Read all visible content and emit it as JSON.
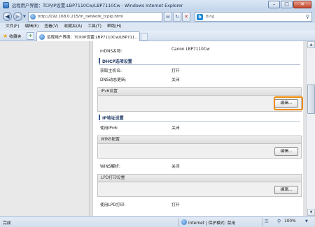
{
  "window": {
    "title": "远程用户界面：TCP/IP设置:LBP7110Cw/LBP7110Cw - Windows Internet Explorer",
    "minimize": "–",
    "maximize": "□",
    "close": "✕"
  },
  "address_bar": {
    "url": "http://192.168.0.215/m_network_tcpip.html",
    "search_placeholder": "Bing"
  },
  "menu": [
    "文件(F)",
    "编辑(E)",
    "查看(V)",
    "收藏夹(A)",
    "工具(T)",
    "帮助(H)"
  ],
  "favorites": {
    "label": "收藏夹",
    "tab_label": "远程用户界面：TCP/IP设置:LBP7110Cw/LBP711..."
  },
  "page": {
    "mdns_label": "mDNS名称:",
    "mdns_value": "Canon LBP7110Cw",
    "dhcp_title": "DHCP选项设置",
    "get_host_label": "获取主机名:",
    "get_host_value": "打开",
    "dns_dynamic_label": "DNS动态更新:",
    "dns_dynamic_value": "关闭",
    "ipv6_title": "IPv6设置",
    "edit_label": "编辑...",
    "ip_addr_title": "IP地址设置",
    "use_ipv6_label": "使用IPv6:",
    "use_ipv6_value": "关闭",
    "wins_title": "WINS配置",
    "wins_resolve_label": "WINS解析:",
    "wins_resolve_value": "关闭",
    "lpd_title": "LPD打印设置",
    "use_lpd_label": "使用LPD打印:",
    "use_lpd_value": "打开"
  },
  "status": {
    "text": "完成",
    "zone": "Internet | 保护模式: 禁用",
    "zoom": "100%"
  }
}
